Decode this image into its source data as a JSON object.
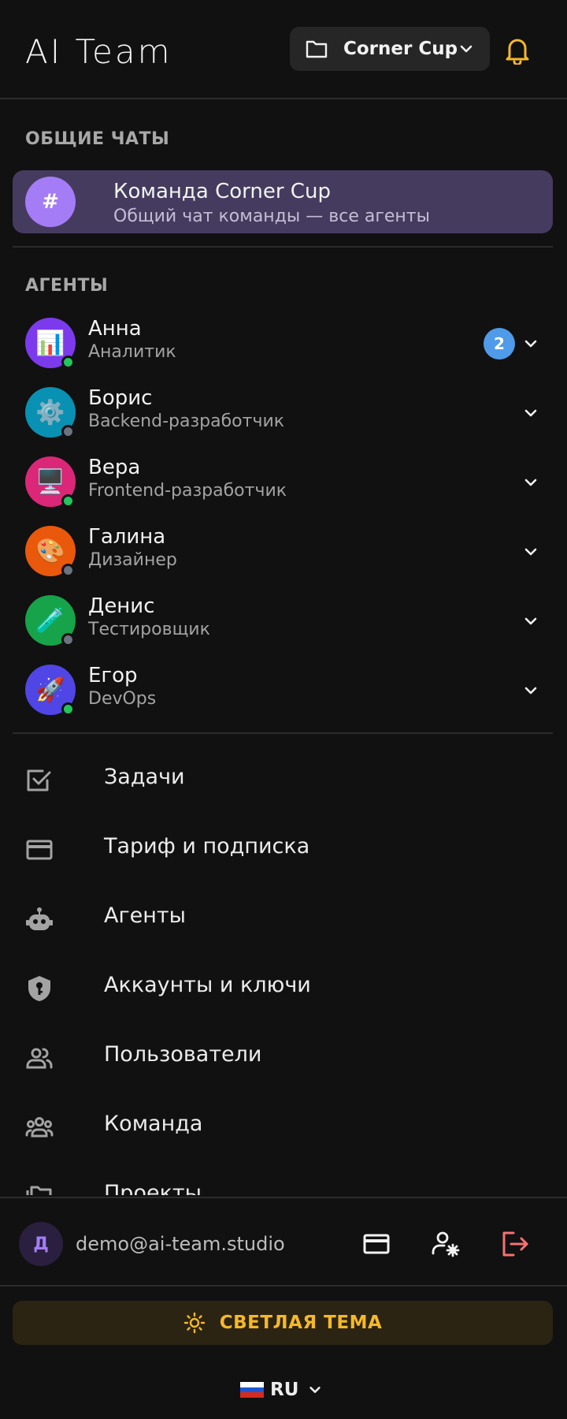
{
  "header": {
    "title": "AI Team",
    "project": "Corner Cup",
    "icons": {
      "folder": "folder-icon",
      "chevron": "chevron-down-icon",
      "bell": "bell-icon"
    }
  },
  "general": {
    "section_title": "ОБЩИЕ ЧАТЫ",
    "chat": {
      "icon": "#",
      "title": "Команда Corner Cup",
      "subtitle": "Общий чат команды — все агенты"
    }
  },
  "agents_section": {
    "title": "АГЕНТЫ",
    "items": [
      {
        "name": "Анна",
        "role": "Аналитик",
        "emoji": "📊",
        "avatar_color": "#7c3aed",
        "online": true,
        "badge": "2"
      },
      {
        "name": "Борис",
        "role": "Backend-разработчик",
        "emoji": "⚙️",
        "avatar_color": "#0891b2",
        "online": false
      },
      {
        "name": "Вера",
        "role": "Frontend-разработчик",
        "emoji": "🖥️",
        "avatar_color": "#db2777",
        "online": true
      },
      {
        "name": "Галина",
        "role": "Дизайнер",
        "emoji": "🎨",
        "avatar_color": "#ea580c",
        "online": false
      },
      {
        "name": "Денис",
        "role": "Тестировщик",
        "emoji": "🧪",
        "avatar_color": "#16a34a",
        "online": false
      },
      {
        "name": "Егор",
        "role": "DevOps",
        "emoji": "🚀",
        "avatar_color": "#4f46e5",
        "online": true
      }
    ]
  },
  "menu": {
    "items": [
      {
        "label": "Задачи",
        "icon": "checkbox-icon"
      },
      {
        "label": "Тариф и подписка",
        "icon": "credit-card-icon"
      },
      {
        "label": "Агенты",
        "icon": "robot-icon"
      },
      {
        "label": "Аккаунты и ключи",
        "icon": "shield-key-icon"
      },
      {
        "label": "Пользователи",
        "icon": "users-icon"
      },
      {
        "label": "Команда",
        "icon": "team-icon"
      }
    ],
    "clipped_item": {
      "label": "Проекты",
      "icon": "folders-icon"
    }
  },
  "footer": {
    "user_initial": "Д",
    "email": "demo@ai-team.studio",
    "icons": [
      "credit-card-icon",
      "user-settings-icon",
      "logout-icon"
    ],
    "theme_label": "СВЕТЛАЯ ТЕМА",
    "language": "RU"
  },
  "colors": {
    "background": "#111111",
    "accent_purple": "#a37cf6",
    "badge_blue": "#4f9bea",
    "bell_yellow": "#f5b829",
    "online": "#22c55e",
    "offline": "#6b7280",
    "logout_red": "#f87171"
  }
}
